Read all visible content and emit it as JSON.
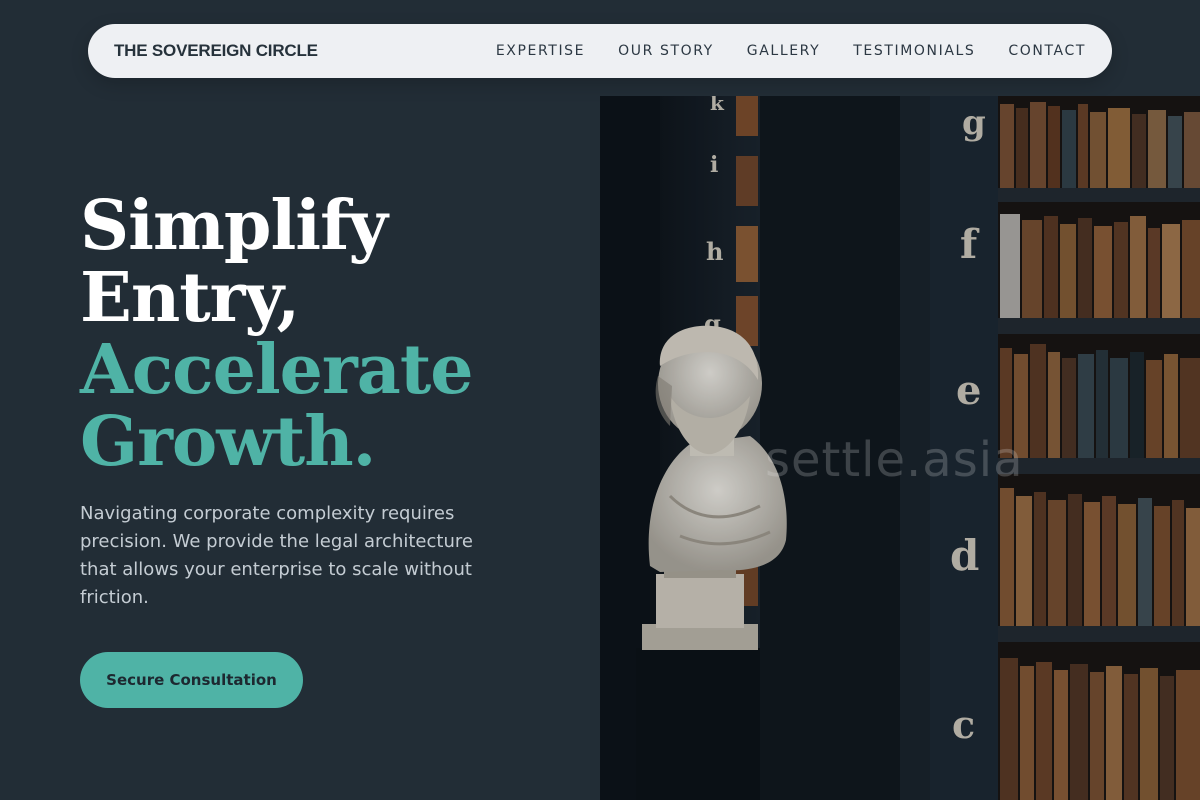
{
  "nav": {
    "brand": "THE SOVEREIGN CIRCLE",
    "items": [
      "EXPERTISE",
      "OUR STORY",
      "GALLERY",
      "TESTIMONIALS",
      "CONTACT"
    ]
  },
  "hero": {
    "title_line1": "Simplify",
    "title_line2": "Entry,",
    "title_line3": "Accelerate",
    "title_line4": "Growth.",
    "description": "Navigating corporate complexity requires precision. We provide the legal architecture that allows your enterprise to scale without friction.",
    "cta_label": "Secure Consultation",
    "image_letters": [
      "k",
      "i",
      "h",
      "g",
      "g",
      "f",
      "e",
      "d",
      "c"
    ],
    "watermark": "settle.asia"
  },
  "colors": {
    "background": "#222d36",
    "accent": "#4fb3a6",
    "nav_bg": "#eef0f3"
  },
  "icons": {
    "hero_image": "library-bust-photo"
  }
}
